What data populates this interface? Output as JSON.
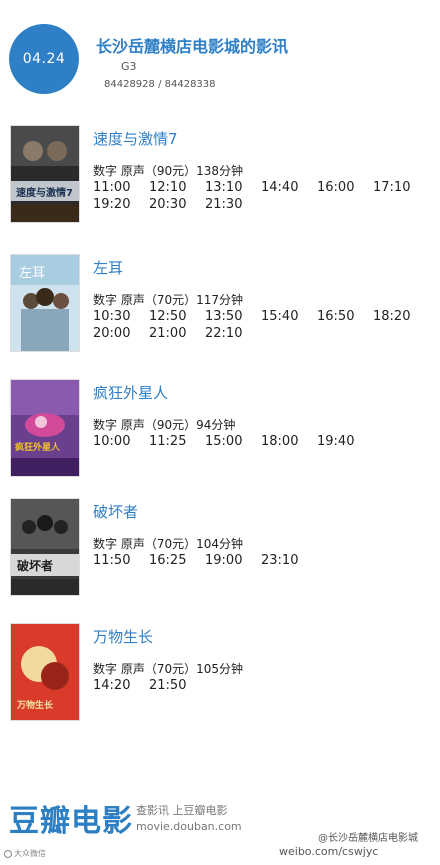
{
  "header": {
    "date": "04.24",
    "cinema_name": "长沙岳麓横店电影城的影讯",
    "address": "G3",
    "phone": "84428928 / 84428338"
  },
  "movies": [
    {
      "title": "速度与激情7",
      "meta": "数字  原声（90元）138分钟",
      "times": [
        "11:00",
        "12:10",
        "13:10",
        "14:40",
        "16:00",
        "17:10",
        "19:20",
        "20:30",
        "21:30"
      ],
      "poster_text": "速度与激情7"
    },
    {
      "title": "左耳",
      "meta": "数字  原声（70元）117分钟",
      "times": [
        "10:30",
        "12:50",
        "13:50",
        "15:40",
        "16:50",
        "18:20",
        "20:00",
        "21:00",
        "22:10"
      ],
      "poster_text": "左耳"
    },
    {
      "title": "疯狂外星人",
      "meta": "数字  原声（90元）94分钟",
      "times": [
        "10:00",
        "11:25",
        "15:00",
        "18:00",
        "19:40"
      ],
      "poster_text": "疯狂外星人"
    },
    {
      "title": "破坏者",
      "meta": "数字  原声（70元）104分钟",
      "times": [
        "11:50",
        "16:25",
        "19:00",
        "23:10"
      ],
      "poster_text": "破坏者"
    },
    {
      "title": "万物生长",
      "meta": "数字  原声（70元）105分钟",
      "times": [
        "14:20",
        "21:50"
      ],
      "poster_text": "万物生长"
    }
  ],
  "footer": {
    "logo": "豆瓣电影",
    "line1": "查影讯  上豆瓣电影",
    "line2": "movie.douban.com"
  },
  "watermarks": {
    "left": "大众微信",
    "weibo": "@长沙岳麓横店电影城",
    "url": "weibo.com/cswjyc"
  },
  "colors": {
    "accent": "#2f7fc7",
    "logo": "#2d7fc4"
  }
}
